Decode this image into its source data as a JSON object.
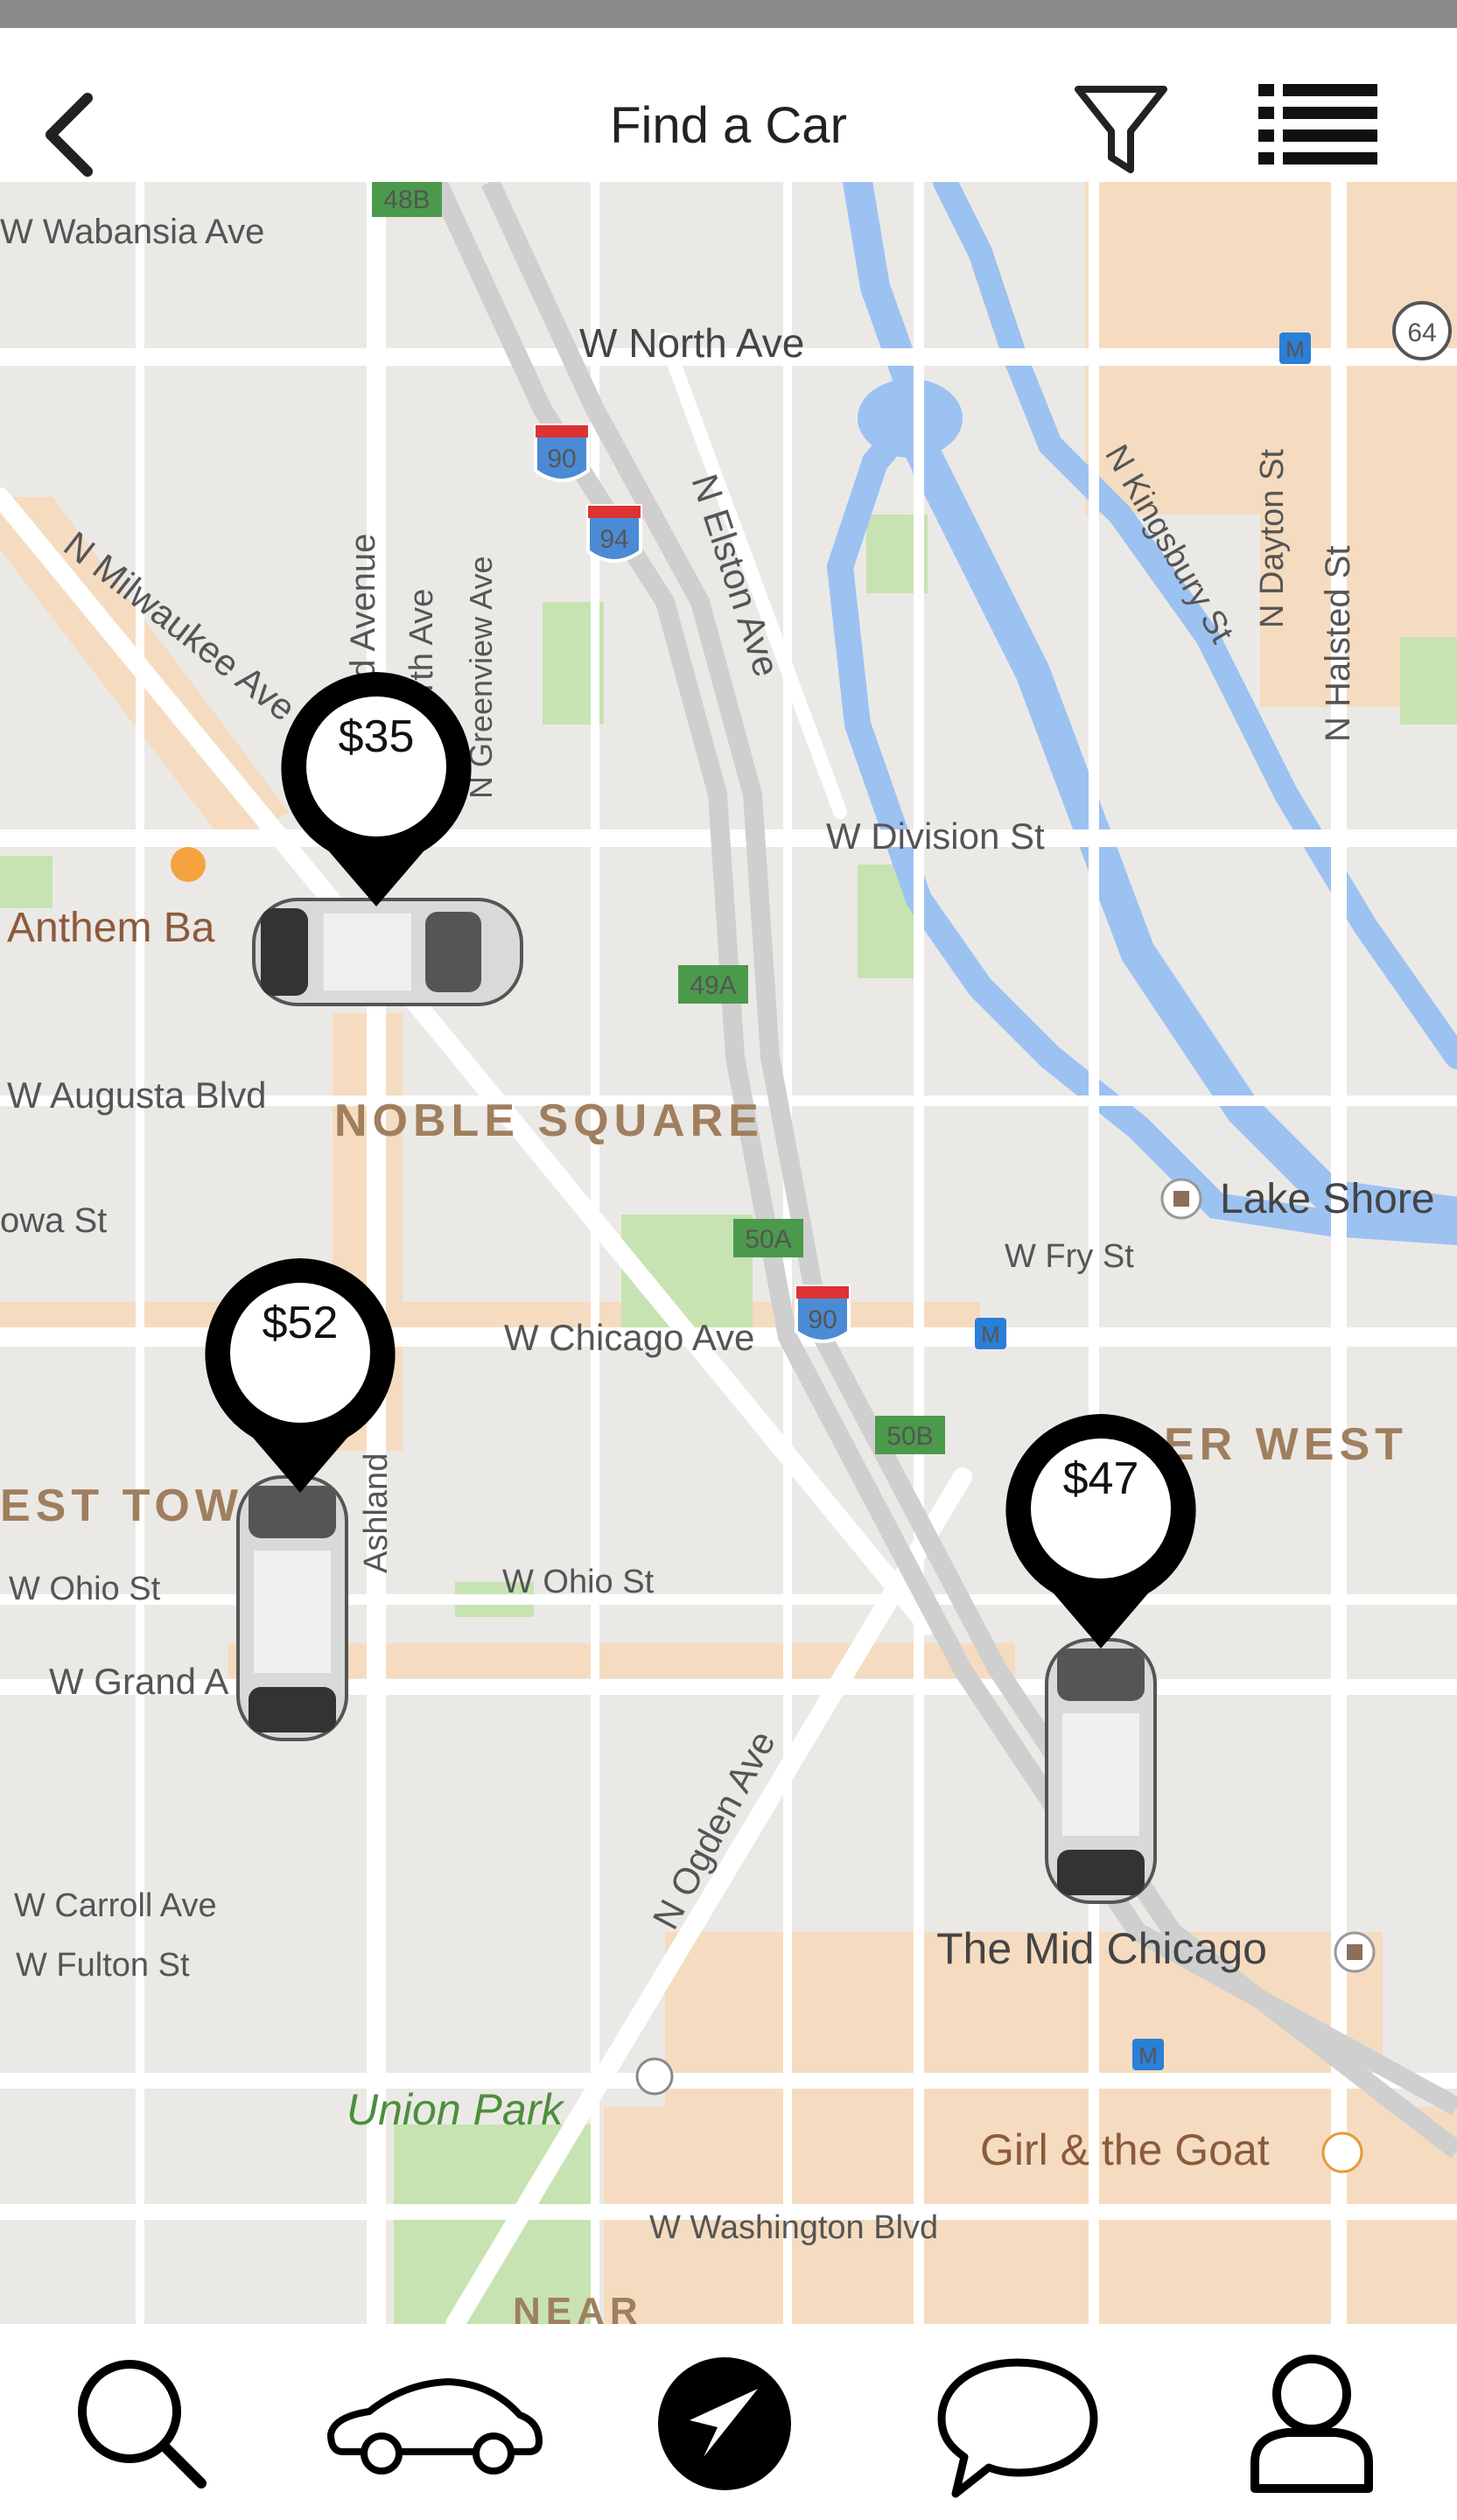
{
  "header": {
    "title": "Find a Car"
  },
  "icons": {
    "back": "chevron-left-icon",
    "filter": "filter-icon",
    "list": "list-icon"
  },
  "map": {
    "labels": {
      "wabansia": "W Wabansia Ave",
      "north_ave": "W North Ave",
      "exit48b": "48B",
      "i90a": "90",
      "i94": "94",
      "route64": "64",
      "milwaukee": "N Milwaukee Ave",
      "ashland_top": "Ashland Avenue",
      "wordsworth": "Wordsworth Ave",
      "greenview": "N Greenview Ave",
      "elston": "N Elston Ave",
      "kingsbury": "N Kingsbury St",
      "dayton": "N Dayton St",
      "halsted": "N Halsted St",
      "division": "W Division St",
      "anthem": "Anthem Ba",
      "exit49a": "49A",
      "augusta": "W Augusta Blvd",
      "noble": "NOBLE SQUARE",
      "iowa": "owa St",
      "lakeshore": "Lake Shore",
      "exit50a": "50A",
      "fry": "W Fry St",
      "chicago_ave": "W Chicago Ave",
      "i90b": "90",
      "exit50b": "50B",
      "river_west": "ER WEST",
      "west_town": "EST TOW",
      "ashland_mid": "Ashland",
      "ohio_left": "W Ohio St",
      "ohio_mid": "W Ohio St",
      "grand": "W Grand A",
      "ogden": "N Ogden Ave",
      "carroll": "W Carroll Ave",
      "fulton": "W Fulton St",
      "mid_chicago": "The Mid Chicago",
      "union_park": "Union Park",
      "girl_goat": "Girl & the Goat",
      "washington": "W Washington Blvd",
      "near": "NEAR",
      "metro1": "M",
      "metro2": "M",
      "metro3": "M"
    }
  },
  "cars": [
    {
      "price": "$35"
    },
    {
      "price": "$52"
    },
    {
      "price": "$47"
    }
  ],
  "tabs": [
    {
      "icon": "search-icon"
    },
    {
      "icon": "car-icon"
    },
    {
      "icon": "navigation-icon"
    },
    {
      "icon": "chat-icon"
    },
    {
      "icon": "profile-icon"
    }
  ],
  "colors": {
    "map_bg": "#ebe9e6",
    "water": "#9cc2f2",
    "park": "#c6e3b1",
    "commercial": "#f5dcc0",
    "highway_shield": "#4b8bd6",
    "exit_green": "#4b9a4b",
    "pin": "#000000"
  }
}
